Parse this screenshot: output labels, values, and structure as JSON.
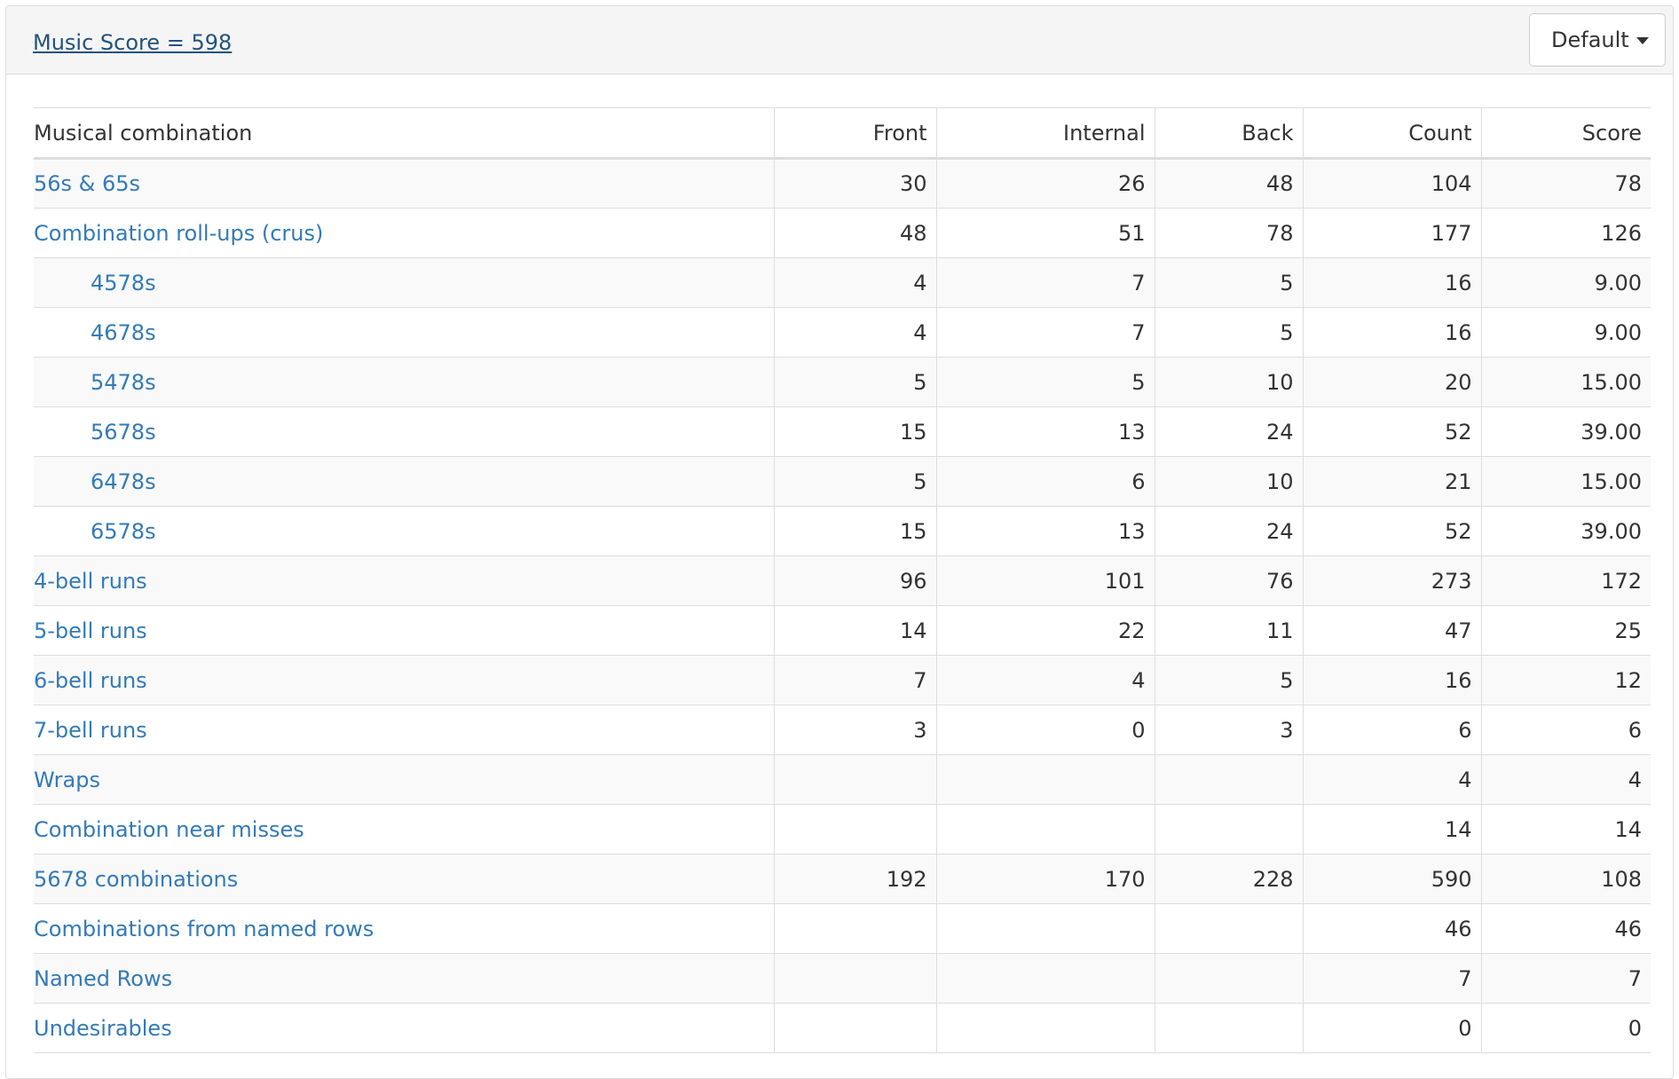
{
  "header": {
    "score_label": "Music Score = 598",
    "dropdown_label": "Default"
  },
  "table": {
    "columns": [
      "Musical combination",
      "Front",
      "Internal",
      "Back",
      "Count",
      "Score"
    ],
    "rows": [
      {
        "name": "56s & 65s",
        "indent": false,
        "front": "30",
        "internal": "26",
        "back": "48",
        "count": "104",
        "score": "78"
      },
      {
        "name": "Combination roll-ups (crus)",
        "indent": false,
        "front": "48",
        "internal": "51",
        "back": "78",
        "count": "177",
        "score": "126"
      },
      {
        "name": "4578s",
        "indent": true,
        "front": "4",
        "internal": "7",
        "back": "5",
        "count": "16",
        "score": "9.00"
      },
      {
        "name": "4678s",
        "indent": true,
        "front": "4",
        "internal": "7",
        "back": "5",
        "count": "16",
        "score": "9.00"
      },
      {
        "name": "5478s",
        "indent": true,
        "front": "5",
        "internal": "5",
        "back": "10",
        "count": "20",
        "score": "15.00"
      },
      {
        "name": "5678s",
        "indent": true,
        "front": "15",
        "internal": "13",
        "back": "24",
        "count": "52",
        "score": "39.00"
      },
      {
        "name": "6478s",
        "indent": true,
        "front": "5",
        "internal": "6",
        "back": "10",
        "count": "21",
        "score": "15.00"
      },
      {
        "name": "6578s",
        "indent": true,
        "front": "15",
        "internal": "13",
        "back": "24",
        "count": "52",
        "score": "39.00"
      },
      {
        "name": "4-bell runs",
        "indent": false,
        "front": "96",
        "internal": "101",
        "back": "76",
        "count": "273",
        "score": "172"
      },
      {
        "name": "5-bell runs",
        "indent": false,
        "front": "14",
        "internal": "22",
        "back": "11",
        "count": "47",
        "score": "25"
      },
      {
        "name": "6-bell runs",
        "indent": false,
        "front": "7",
        "internal": "4",
        "back": "5",
        "count": "16",
        "score": "12"
      },
      {
        "name": "7-bell runs",
        "indent": false,
        "front": "3",
        "internal": "0",
        "back": "3",
        "count": "6",
        "score": "6"
      },
      {
        "name": "Wraps",
        "indent": false,
        "front": "",
        "internal": "",
        "back": "",
        "count": "4",
        "score": "4"
      },
      {
        "name": "Combination near misses",
        "indent": false,
        "front": "",
        "internal": "",
        "back": "",
        "count": "14",
        "score": "14"
      },
      {
        "name": "5678 combinations",
        "indent": false,
        "front": "192",
        "internal": "170",
        "back": "228",
        "count": "590",
        "score": "108"
      },
      {
        "name": "Combinations from named rows",
        "indent": false,
        "front": "",
        "internal": "",
        "back": "",
        "count": "46",
        "score": "46"
      },
      {
        "name": "Named Rows",
        "indent": false,
        "front": "",
        "internal": "",
        "back": "",
        "count": "7",
        "score": "7"
      },
      {
        "name": "Undesirables",
        "indent": false,
        "front": "",
        "internal": "",
        "back": "",
        "count": "0",
        "score": "0"
      }
    ]
  },
  "colors": {
    "link": "#337ab7",
    "heading_link": "#23527c",
    "stripe": "#f9f9f9",
    "border": "#dddddd"
  }
}
